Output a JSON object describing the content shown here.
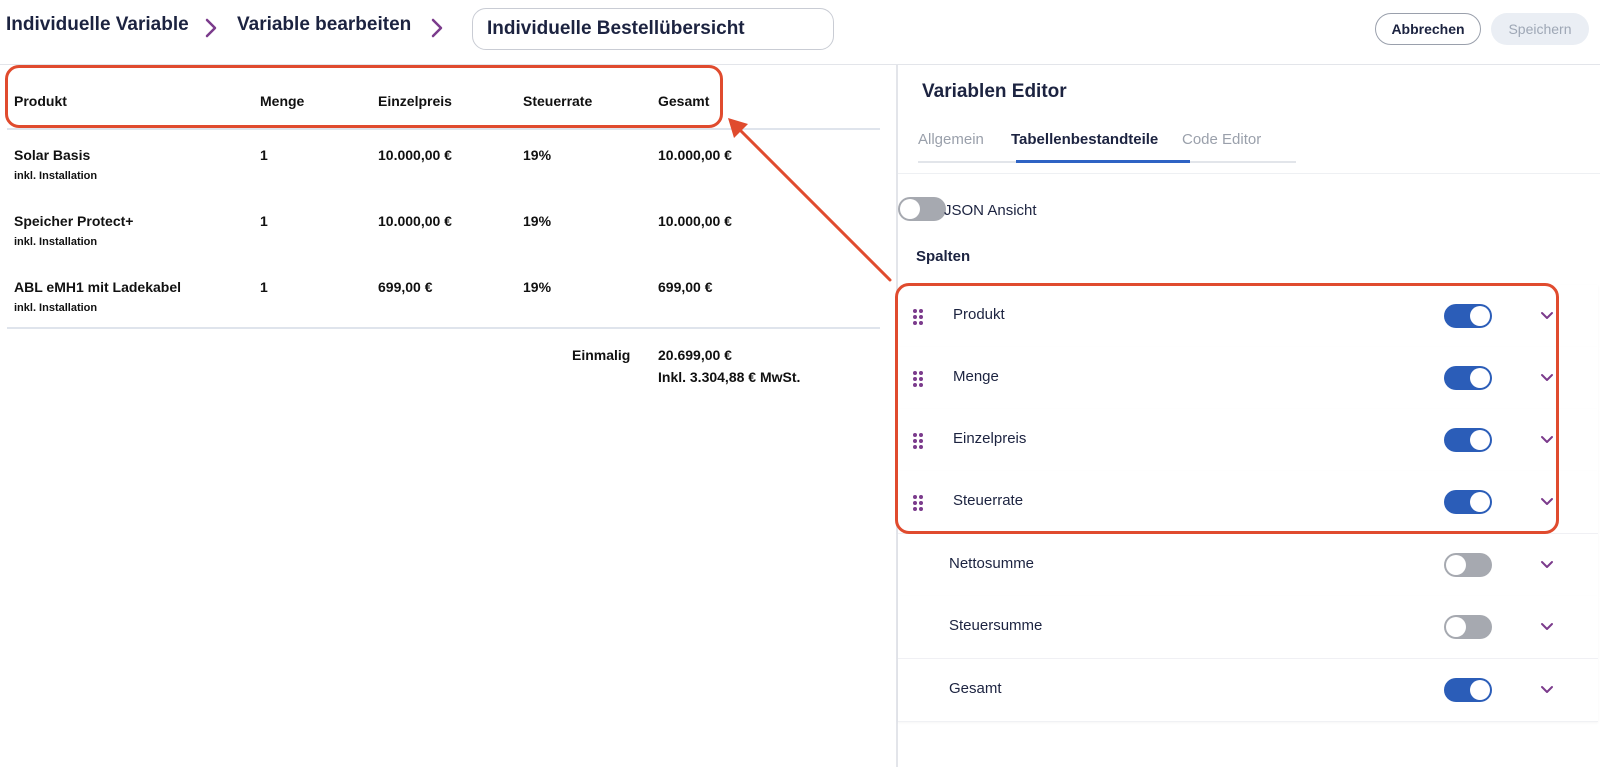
{
  "header": {
    "breadcrumb": [
      "Individuelle Variable",
      "Variable bearbeiten"
    ],
    "name_value": "Individuelle Bestellübersicht",
    "cancel_label": "Abbrechen",
    "save_label": "Speichern",
    "breadcrumb_separator_icon": "chevron-right-icon"
  },
  "preview": {
    "columns": [
      "Produkt",
      "Menge",
      "Einzelpreis",
      "Steuerrate",
      "Gesamt"
    ],
    "rows": [
      {
        "produkt": "Solar Basis",
        "note": "inkl. Installation",
        "menge": "1",
        "einzelpreis": "10.000,00 €",
        "steuerrate": "19%",
        "gesamt": "10.000,00 €"
      },
      {
        "produkt": "Speicher Protect+",
        "note": "inkl. Installation",
        "menge": "1",
        "einzelpreis": "10.000,00 €",
        "steuerrate": "19%",
        "gesamt": "10.000,00 €"
      },
      {
        "produkt": "ABL eMH1 mit Ladekabel",
        "note": "inkl. Installation",
        "menge": "1",
        "einzelpreis": "699,00 €",
        "steuerrate": "19%",
        "gesamt": "699,00 €"
      }
    ],
    "summary": {
      "label": "Einmalig",
      "total": "20.699,00 €",
      "tax_note": "Inkl. 3.304,88 € MwSt."
    }
  },
  "editor": {
    "title": "Variablen Editor",
    "tabs": [
      "Allgemein",
      "Tabellenbestandteile",
      "Code Editor"
    ],
    "active_tab": "Tabellenbestandteile",
    "json_view_label": "JSON Ansicht",
    "json_view_on": false,
    "section_label": "Spalten",
    "columns": [
      {
        "label": "Produkt",
        "enabled": true,
        "draggable": true
      },
      {
        "label": "Menge",
        "enabled": true,
        "draggable": true
      },
      {
        "label": "Einzelpreis",
        "enabled": true,
        "draggable": true
      },
      {
        "label": "Steuerrate",
        "enabled": true,
        "draggable": true
      },
      {
        "label": "Nettosumme",
        "enabled": false,
        "draggable": false
      },
      {
        "label": "Steuersumme",
        "enabled": false,
        "draggable": false
      },
      {
        "label": "Gesamt",
        "enabled": true,
        "draggable": false
      }
    ]
  },
  "colors": {
    "accent": "#2b5db8",
    "annotation": "#e04b2e",
    "drag_handle": "#7b3b8c",
    "text": "#1c2340"
  }
}
